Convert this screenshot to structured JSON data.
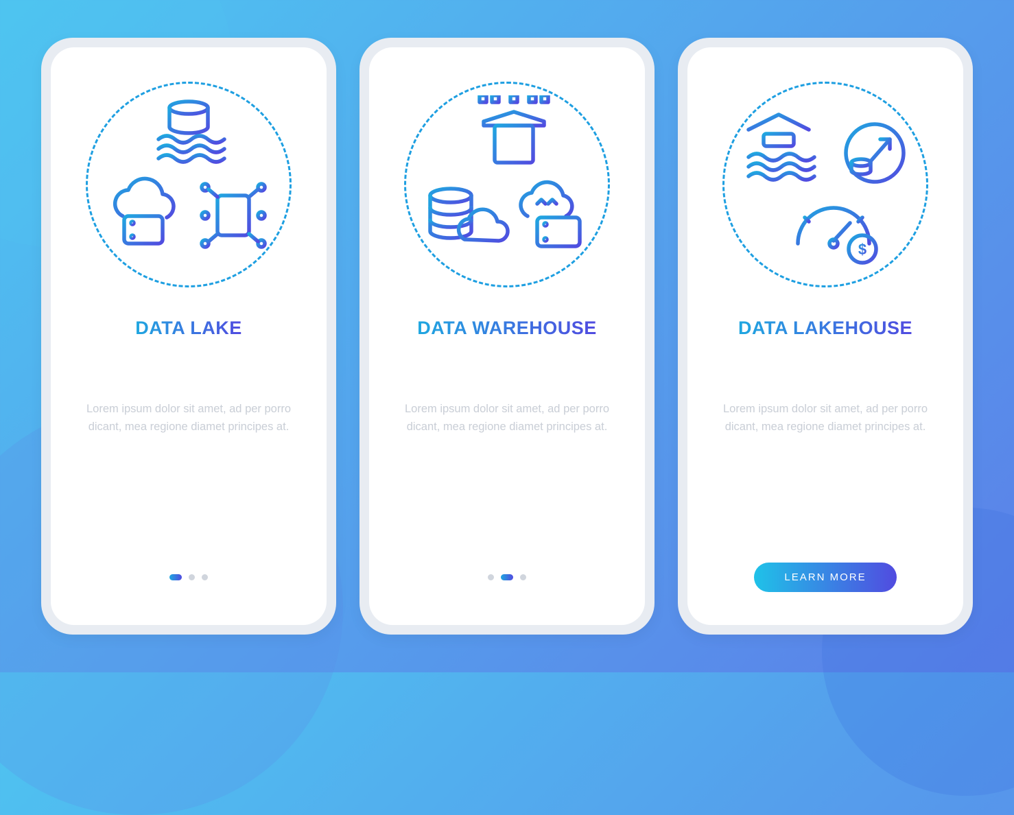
{
  "colors": {
    "grad_start": "#1FA7E0",
    "grad_end": "#514BE0",
    "muted": "#C9CED6"
  },
  "screens": [
    {
      "title": "DATA LAKE",
      "desc": "Lorem ipsum dolor sit amet, ad per porro dicant, mea regione diamet principes at.",
      "icons": [
        "database-waves-icon",
        "cloud-server-icon",
        "network-server-icon"
      ],
      "page_index": 0,
      "total_pages": 3,
      "cta": null
    },
    {
      "title": "DATA WAREHOUSE",
      "desc": "Lorem ipsum dolor sit amet, ad per porro dicant, mea regione diamet principes at.",
      "icons": [
        "warehouse-network-icon",
        "database-cloud-icon",
        "cloud-upload-server-icon"
      ],
      "page_index": 1,
      "total_pages": 3,
      "cta": null
    },
    {
      "title": "DATA LAKEHOUSE",
      "desc": "Lorem ipsum dolor sit amet, ad per porro dicant, mea regione diamet principes at.",
      "icons": [
        "house-waves-icon",
        "growth-circle-icon",
        "cost-gauge-icon"
      ],
      "page_index": 2,
      "total_pages": 3,
      "cta": "LEARN MORE"
    }
  ]
}
